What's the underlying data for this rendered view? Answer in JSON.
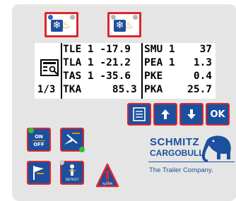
{
  "mode_buttons": [
    {
      "name": "left"
    },
    {
      "name": "right"
    }
  ],
  "display": {
    "page": "1/3",
    "rows": [
      {
        "left": "TLE 1 -17.9",
        "right": "SMU 1    37"
      },
      {
        "left": "TLA 1 -21.2",
        "right": "PEA 1   1.3"
      },
      {
        "left": "TAS 1 -35.6",
        "right": "PKE     0.4"
      },
      {
        "left": "TKA     85.3",
        "right": "PKA    25.7"
      }
    ]
  },
  "nav": {
    "ok_label": "OK"
  },
  "controls": {
    "onoff_label_on": "ON",
    "onoff_label_off": "OFF",
    "defrost_label": "DEFROST",
    "alarm_label": "ALARM"
  },
  "brand": {
    "line1": "SCHMITZ",
    "line2": "CARGOBULL",
    "tagline": "The Trailer Company."
  },
  "colors": {
    "accent_red": "#e0252a",
    "accent_blue": "#1c4f9e",
    "heat_orange": "#e3891f"
  },
  "icons": [
    "snowflake-icon",
    "heat-icon",
    "list-icon",
    "arrow-up-icon",
    "arrow-down-icon",
    "power-icon",
    "sensor-icon",
    "flag-icon",
    "defrost-icon",
    "alarm-icon",
    "elephant-icon",
    "menu-icon"
  ]
}
